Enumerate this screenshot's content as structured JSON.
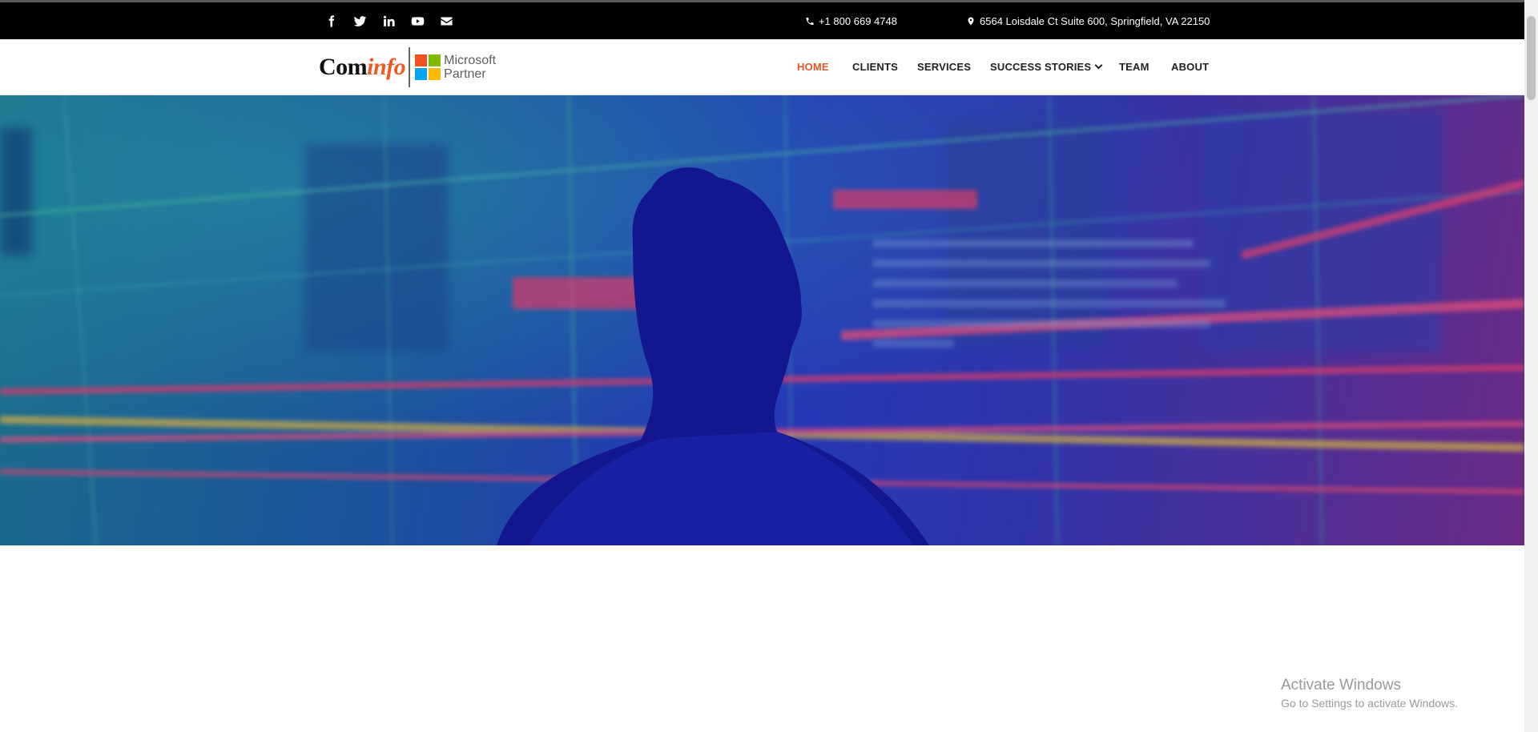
{
  "topbar": {
    "social_icons": [
      "facebook-icon",
      "twitter-icon",
      "linkedin-icon",
      "youtube-icon",
      "envelope-icon"
    ],
    "phone": "+1 800 669 4748",
    "address": "6564 Loisdale Ct Suite 600, Springfield, VA 22150"
  },
  "logo": {
    "word_start": "Com",
    "word_accent": "info",
    "partner_line1": "Microsoft",
    "partner_line2": "Partner"
  },
  "nav": {
    "items": [
      {
        "label": "HOME",
        "active": true
      },
      {
        "label": "CLIENTS",
        "active": false
      },
      {
        "label": "SERVICES",
        "active": false
      },
      {
        "label": "SUCCESS STORIES",
        "active": false,
        "dropdown": true
      },
      {
        "label": "TEAM",
        "active": false
      },
      {
        "label": "ABOUT",
        "active": false
      }
    ]
  },
  "hero": {
    "image": "woman-silhouette-facing-digital-display"
  },
  "watermark": {
    "title": "Activate Windows",
    "subtitle": "Go to Settings to activate Windows."
  },
  "colors": {
    "accent": "#e8532a",
    "topbar_bg": "#000000",
    "logo_accent": "#f05a22"
  }
}
